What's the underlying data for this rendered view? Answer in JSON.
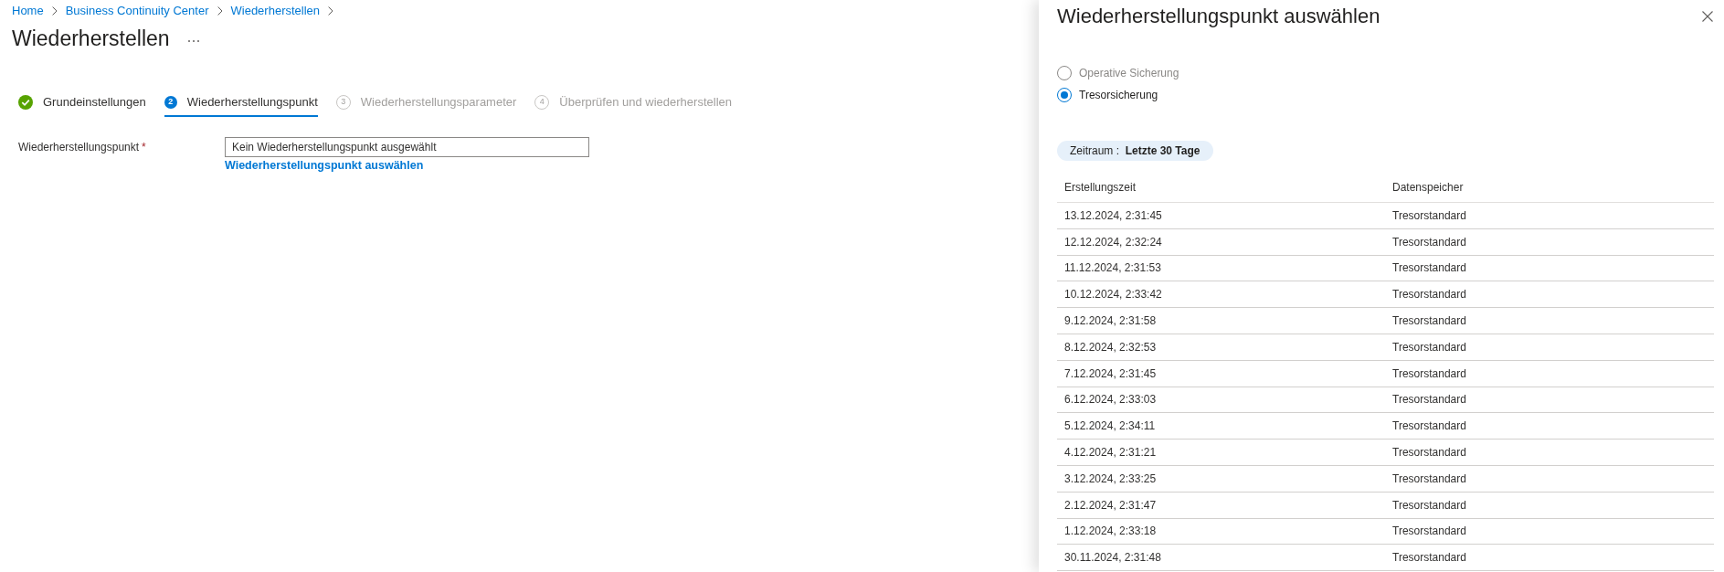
{
  "breadcrumb": [
    "Home",
    "Business Continuity Center",
    "Wiederherstellen"
  ],
  "page": {
    "title": "Wiederherstellen"
  },
  "steps": [
    {
      "label": "Grundeinstellungen",
      "completed": true,
      "selected": false,
      "disabled": false
    },
    {
      "number": "2",
      "label": "Wiederherstellungspunkt",
      "completed": false,
      "selected": true,
      "disabled": false
    },
    {
      "number": "3",
      "label": "Wiederherstellungsparameter",
      "completed": false,
      "selected": false,
      "disabled": true
    },
    {
      "number": "4",
      "label": "Überprüfen und wiederherstellen",
      "completed": false,
      "selected": false,
      "disabled": true
    }
  ],
  "form": {
    "fields": [
      {
        "label": "Wiederherstellungspunkt",
        "required_marker": "*",
        "value": "Kein Wiederherstellungspunkt ausgewählt",
        "link": "Wiederherstellungspunkt auswählen"
      }
    ]
  },
  "panel": {
    "title": "Wiederherstellungspunkt auswählen",
    "options": [
      {
        "label": "Operative Sicherung",
        "selected": false,
        "disabled": true
      },
      {
        "label": "Tresorsicherung",
        "selected": true,
        "disabled": false
      }
    ],
    "filter": {
      "text": "Zeitraum :  **Letzte 30 Tage**"
    },
    "table": {
      "columns": [
        "Erstellungszeit",
        "Datenspeicher"
      ],
      "rows": [
        [
          "13.12.2024, 2:31:45",
          "Tresorstandard"
        ],
        [
          "12.12.2024, 2:32:24",
          "Tresorstandard"
        ],
        [
          "11.12.2024, 2:31:53",
          "Tresorstandard"
        ],
        [
          "10.12.2024, 2:33:42",
          "Tresorstandard"
        ],
        [
          "9.12.2024, 2:31:58",
          "Tresorstandard"
        ],
        [
          "8.12.2024, 2:32:53",
          "Tresorstandard"
        ],
        [
          "7.12.2024, 2:31:45",
          "Tresorstandard"
        ],
        [
          "6.12.2024, 2:33:03",
          "Tresorstandard"
        ],
        [
          "5.12.2024, 2:34:11",
          "Tresorstandard"
        ],
        [
          "4.12.2024, 2:31:21",
          "Tresorstandard"
        ],
        [
          "3.12.2024, 2:33:25",
          "Tresorstandard"
        ],
        [
          "2.12.2024, 2:31:47",
          "Tresorstandard"
        ],
        [
          "1.12.2024, 2:33:18",
          "Tresorstandard"
        ],
        [
          "30.11.2024, 2:31:48",
          "Tresorstandard"
        ]
      ]
    }
  }
}
